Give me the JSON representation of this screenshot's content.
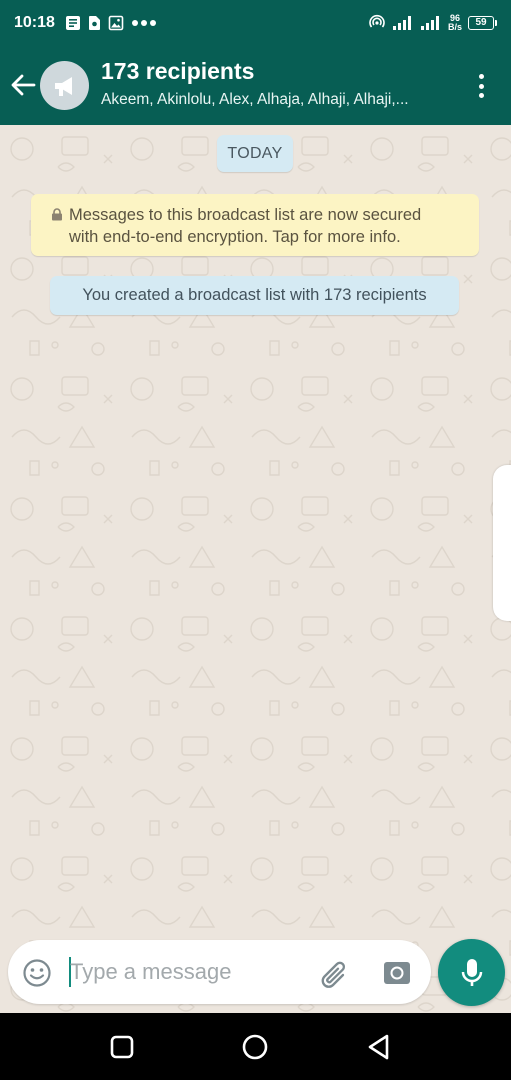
{
  "status_bar": {
    "time": "10:18",
    "net_speed_value": "96",
    "net_speed_unit": "B/s",
    "battery": "59"
  },
  "header": {
    "title": "173 recipients",
    "subtitle": "Akeem, Akinlolu, Alex, Alhaja, Alhaji, Alhaji,..."
  },
  "chat": {
    "date_label": "TODAY",
    "encryption_line1": "Messages to this broadcast list are now secured",
    "encryption_line2": "with end-to-end encryption. Tap for more info.",
    "system_message": "You created a broadcast list with 173 recipients"
  },
  "composer": {
    "placeholder": "Type a message"
  },
  "colors": {
    "header": "#075E54",
    "accent": "#128C7E",
    "chat_background": "#ECE5DD",
    "notice_yellow": "#FCF4C4",
    "notice_blue": "#D5EAF3"
  }
}
